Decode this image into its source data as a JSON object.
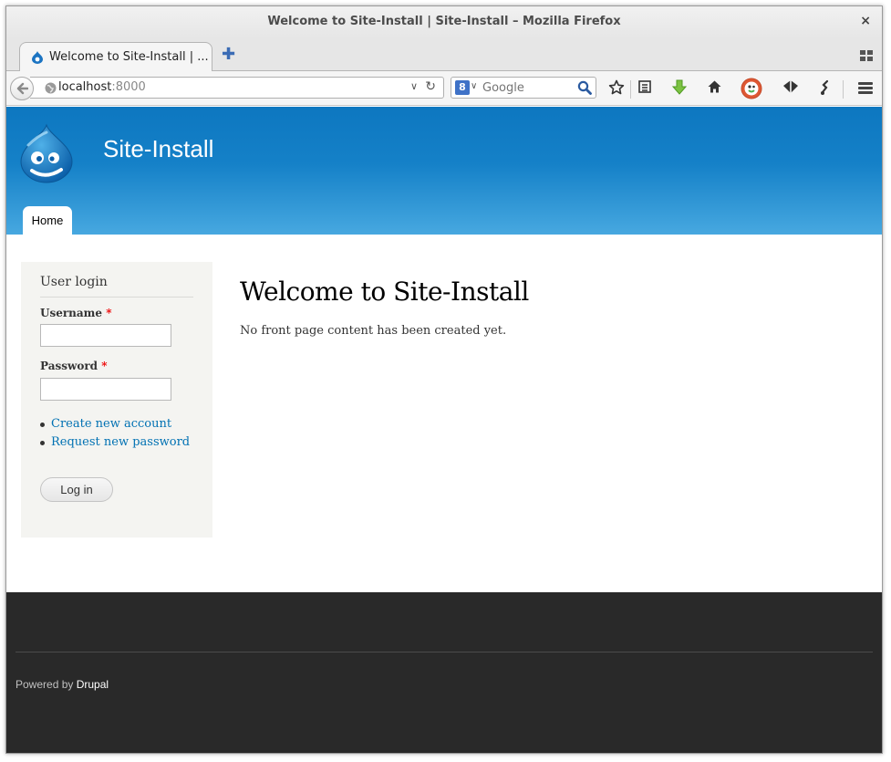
{
  "window": {
    "title": "Welcome to Site-Install | Site-Install – Mozilla Firefox",
    "close_glyph": "×"
  },
  "tabs": [
    {
      "label": "Welcome to Site-Install | ...",
      "icon": "drupal-favicon-icon",
      "active": true
    }
  ],
  "tabstrip": {
    "new_tab_glyph": "✚"
  },
  "navbar": {
    "url_host": "localhost",
    "url_port": ":8000",
    "url_dropdown_glyph": "∨",
    "reload_glyph": "↻",
    "search_engine_badge": "8",
    "search_dropdown_glyph": "∨",
    "search_placeholder": "Google"
  },
  "site": {
    "name": "Site-Install",
    "nav_tabs": [
      "Home"
    ]
  },
  "login_block": {
    "title": "User login",
    "username_label": "Username",
    "password_label": "Password",
    "required_mark": "*",
    "links": [
      "Create new account",
      "Request new password"
    ],
    "submit_label": "Log in"
  },
  "main": {
    "title": "Welcome to Site-Install",
    "body": "No front page content has been created yet."
  },
  "footer": {
    "powered_prefix": "Powered by ",
    "powered_link": "Drupal"
  },
  "colors": {
    "header_top": "#0d77c0",
    "header_bottom": "#47a8e0",
    "link": "#0071b3",
    "required": "#ee0000",
    "footer_bg": "#292929",
    "sidebar_bg": "#f4f4f1"
  }
}
